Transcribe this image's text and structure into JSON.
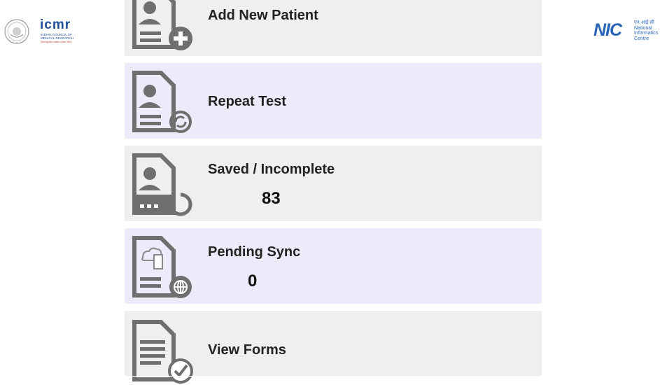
{
  "logos": {
    "left": {
      "brand": "icmr",
      "line1": "INDIAN COUNCIL OF",
      "line2": "MEDICAL RESEARCH",
      "tagline": "Serving the nation since 1911"
    },
    "right": {
      "brand": "NIC",
      "line1": "एन आई सी",
      "line2": "National",
      "line3": "Informatics",
      "line4": "Centre"
    }
  },
  "menu": {
    "items": [
      {
        "label": "Add New Patient",
        "icon": "add-patient-icon"
      },
      {
        "label": "Repeat Test",
        "icon": "repeat-test-icon"
      },
      {
        "label": "Saved / Incomplete",
        "count": "83",
        "icon": "saved-incomplete-icon"
      },
      {
        "label": "Pending Sync",
        "count": "0",
        "icon": "pending-sync-icon"
      },
      {
        "label": "View Forms",
        "icon": "view-forms-icon"
      }
    ]
  },
  "colors": {
    "card_gray": "#efefef",
    "card_lavender": "#ecebfa",
    "icon_gray": "#6f6f6f",
    "brand_blue": "#1f4e9a"
  }
}
